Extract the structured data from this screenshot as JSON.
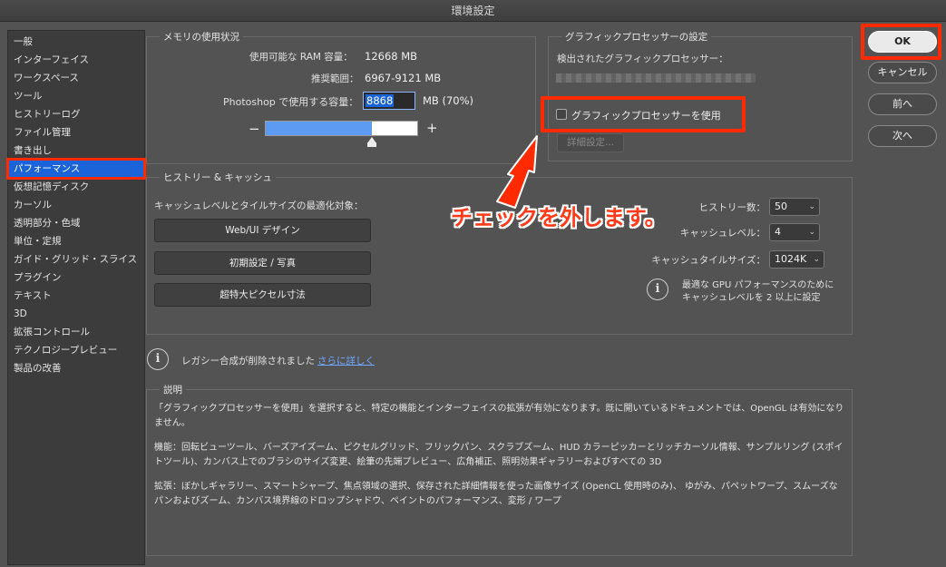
{
  "window": {
    "title": "環境設定"
  },
  "sidebar": {
    "items": [
      {
        "label": "一般"
      },
      {
        "label": "インターフェイス"
      },
      {
        "label": "ワークスペース"
      },
      {
        "label": "ツール"
      },
      {
        "label": "ヒストリーログ"
      },
      {
        "label": "ファイル管理"
      },
      {
        "label": "書き出し"
      },
      {
        "label": "パフォーマンス",
        "selected": true
      },
      {
        "label": "仮想記憶ディスク"
      },
      {
        "label": "カーソル"
      },
      {
        "label": "透明部分・色域"
      },
      {
        "label": "単位・定規"
      },
      {
        "label": "ガイド・グリッド・スライス"
      },
      {
        "label": "プラグイン"
      },
      {
        "label": "テキスト"
      },
      {
        "label": "3D"
      },
      {
        "label": "拡張コントロール"
      },
      {
        "label": "テクノロジープレビュー"
      },
      {
        "label": "製品の改善"
      }
    ]
  },
  "memory": {
    "title": "メモリの使用状況",
    "available_label": "使用可能な RAM 容量：",
    "available_value": "12668 MB",
    "recommended_label": "推奨範囲：",
    "recommended_value": "6967-9121 MB",
    "usage_label": "Photoshop で使用する容量：",
    "usage_value": "8868",
    "usage_unit": "MB (70%)",
    "slider_fraction": 0.7,
    "minus": "−",
    "plus": "+"
  },
  "gpu": {
    "title": "グラフィックプロセッサーの設定",
    "detected_label": "検出されたグラフィックプロセッサー：",
    "use_gpu_label": "グラフィックプロセッサーを使用",
    "use_gpu_checked": false,
    "advanced_button": "詳細設定..."
  },
  "history_cache": {
    "title": "ヒストリー & キャッシュ",
    "optimize_label": "キャッシュレベルとタイルサイズの最適化対象：",
    "buttons": [
      "Web/UI デザイン",
      "初期設定 / 写真",
      "超特大ピクセル寸法"
    ],
    "history_states_label": "ヒストリー数：",
    "history_states_value": "50",
    "cache_levels_label": "キャッシュレベル：",
    "cache_levels_value": "4",
    "tile_size_label": "キャッシュタイルサイズ：",
    "tile_size_value": "1024K",
    "info_line1": "最適な GPU パフォーマンスのために",
    "info_line2": "キャッシュレベルを 2 以上に設定"
  },
  "legacy": {
    "text": "レガシー合成が削除されました",
    "link": "さらに詳しく"
  },
  "description": {
    "title": "説明",
    "para1": "「グラフィックプロセッサーを使用」を選択すると、特定の機能とインターフェイスの拡張が有効になります。既に開いているドキュメントでは、OpenGL は有効になりません。",
    "para2": "機能：回転ビューツール、バーズアイズーム、ピクセルグリッド、フリックパン、スクラブズーム、HUD カラーピッカーとリッチカーソル情報、サンプルリング (スポイトツール)、カンバス上でのブラシのサイズ変更、絵筆の先端プレビュー、広角補正、照明効果ギャラリーおよびすべての 3D",
    "para3": "拡張：ぼかしギャラリー、スマートシャープ、焦点領域の選択、保存された詳細情報を使った画像サイズ (OpenCL 使用時のみ)、 ゆがみ、パペットワープ、スムーズなパンおよびズーム、カンバス境界線のドロップシャドウ、ペイントのパフォーマンス、変形 / ワープ"
  },
  "actions": {
    "ok": "OK",
    "cancel": "キャンセル",
    "prev": "前へ",
    "next": "次へ"
  },
  "annotation": {
    "text": "チェックを外します。"
  },
  "colors": {
    "accent": "#1a63d8",
    "highlight": "#ff2a00",
    "annotation_text": "#ff3a1a"
  }
}
